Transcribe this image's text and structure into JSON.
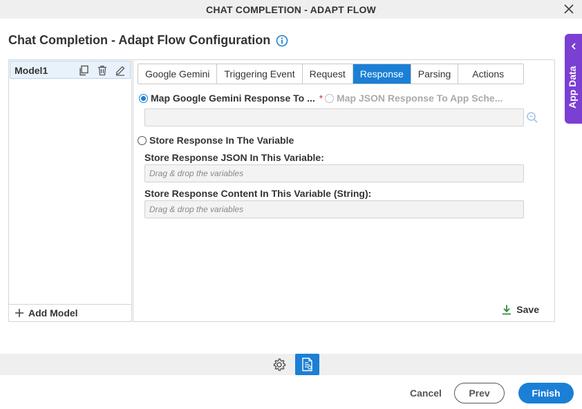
{
  "window": {
    "title": "CHAT COMPLETION - ADAPT FLOW"
  },
  "page": {
    "heading": "Chat Completion - Adapt Flow Configuration"
  },
  "side_tab": {
    "label": "App Data"
  },
  "models": {
    "items": [
      {
        "label": "Model1"
      }
    ],
    "add_label": "Add Model"
  },
  "tabs": [
    {
      "label": "Google Gemini",
      "active": false
    },
    {
      "label": "Triggering Event",
      "active": false
    },
    {
      "label": "Request",
      "active": false
    },
    {
      "label": "Response",
      "active": true
    },
    {
      "label": "Parsing",
      "active": false
    },
    {
      "label": "Actions",
      "active": false
    }
  ],
  "response": {
    "map_gemini_label": "Map Google Gemini Response To ...",
    "required_mark": "*",
    "map_json_label": "Map JSON Response To App Sche...",
    "map_value": "",
    "store_variable_label": "Store Response In The Variable",
    "json_var_label": "Store Response JSON In This Variable:",
    "json_var_placeholder": "Drag & drop the variables",
    "content_var_label": "Store Response Content In This Variable (String):",
    "content_var_placeholder": "Drag & drop the variables",
    "save_label": "Save"
  },
  "footer": {
    "cancel_label": "Cancel",
    "prev_label": "Prev",
    "finish_label": "Finish"
  },
  "colors": {
    "accent": "#1b7fd6",
    "app_data_tab": "#7b3fd4",
    "required": "#e03030",
    "save_icon": "#2e8b3a"
  }
}
